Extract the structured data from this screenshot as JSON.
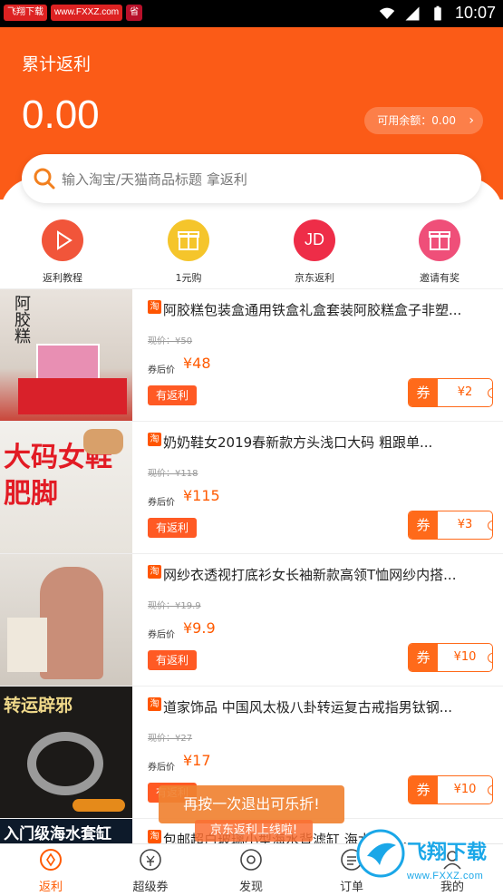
{
  "statusbar": {
    "badges": [
      "飞翔下载",
      "www.FXXZ.com",
      "省"
    ],
    "time": "10:07"
  },
  "header": {
    "title": "累计返利",
    "amount": "0.00",
    "balance": "可用余额：0.00"
  },
  "search": {
    "placeholder": "输入淘宝/天猫商品标题 拿返利"
  },
  "quick": [
    {
      "label": "返利教程",
      "icon": "play-icon",
      "color": "#f1553a"
    },
    {
      "label": "1元购",
      "icon": "gift-icon",
      "color": "#f5c52b"
    },
    {
      "label": "京东返利",
      "icon": "jd-icon",
      "color": "#ee2d48",
      "text": "JD"
    },
    {
      "label": "邀请有奖",
      "icon": "gift-icon",
      "color": "#ef4f79"
    }
  ],
  "products": [
    {
      "title": "阿胶糕包装盒通用铁盒礼盒套装阿胶糕盒子非塑...",
      "orig": "现价：¥50",
      "after_label": "券后价",
      "after": "¥48",
      "rebate": "有返利",
      "coupon_label": "券",
      "coupon": "¥2",
      "thumb_text": "阿胶糕"
    },
    {
      "title": "奶奶鞋女2019春新款方头浅口大码 粗跟单...",
      "orig": "现价：¥118",
      "after_label": "券后价",
      "after": "¥115",
      "rebate": "有返利",
      "coupon_label": "券",
      "coupon": "¥3",
      "thumb_text": "大码女鞋肥脚"
    },
    {
      "title": "网纱衣透视打底衫女长袖新款高领T恤网纱内搭...",
      "orig": "现价：¥19.9",
      "after_label": "券后价",
      "after": "¥9.9",
      "rebate": "有返利",
      "coupon_label": "券",
      "coupon": "¥10",
      "thumb_text": ""
    },
    {
      "title": "道家饰品 中国风太极八卦转运复古戒指男钛钢...",
      "orig": "现价：¥27",
      "after_label": "券后价",
      "after": "¥17",
      "rebate": "有返利",
      "coupon_label": "券",
      "coupon": "¥10",
      "thumb_text": "转运辟邪"
    },
    {
      "title": "包邮超白玻璃小型海水背滤缸 海水鱼金...",
      "thumb_text": "入门级海水套缸"
    }
  ],
  "toast": {
    "message": "再按一次退出可乐折!",
    "sub": "京东返利上线啦!"
  },
  "bottomnav": [
    {
      "label": "返利",
      "icon": "rebate-icon",
      "active": true
    },
    {
      "label": "超级券",
      "icon": "coupon-icon",
      "active": false
    },
    {
      "label": "发现",
      "icon": "discover-icon",
      "active": false
    },
    {
      "label": "订单",
      "icon": "order-icon",
      "active": false
    },
    {
      "label": "我的",
      "icon": "profile-icon",
      "active": false
    }
  ],
  "watermark": {
    "text": "飞翔下载",
    "url": "www.FXXZ.com"
  },
  "colors": {
    "primary": "#fb5b17",
    "accent": "#ff5a00",
    "watermark": "#1aa7e8"
  }
}
